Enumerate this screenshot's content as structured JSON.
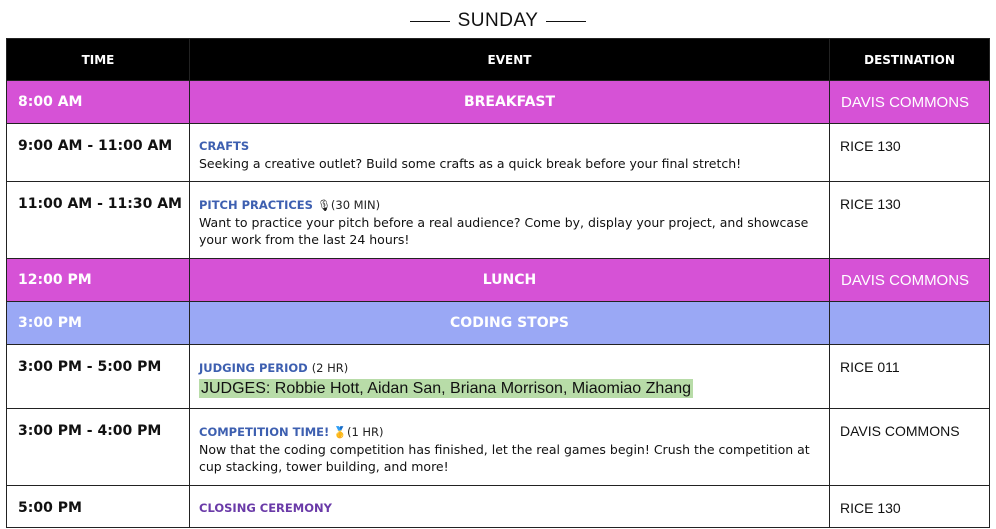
{
  "day": "SUNDAY",
  "columns": {
    "time": "TIME",
    "event": "EVENT",
    "destination": "DESTINATION"
  },
  "rows": [
    {
      "time": "8:00 AM",
      "event": "BREAKFAST",
      "destination": "DAVIS COMMONS"
    },
    {
      "time": "9:00 AM - 11:00 AM",
      "title": "CRAFTS",
      "description": "Seeking a creative outlet? Build some crafts as a quick break before your final stretch!",
      "destination": "RICE 130"
    },
    {
      "time": "11:00 AM - 11:30 AM",
      "title": "PITCH PRACTICES",
      "icon": "microphone-icon",
      "icon_glyph": "🎙",
      "extra": "(30 MIN)",
      "description": "Want to practice your pitch before a real audience? Come by, display your project, and showcase your work from the last 24 hours!",
      "destination": "RICE 130"
    },
    {
      "time": "12:00 PM",
      "event": "LUNCH",
      "destination": "DAVIS COMMONS"
    },
    {
      "time": "3:00 PM",
      "event": "CODING STOPS",
      "destination": ""
    },
    {
      "time": "3:00 PM - 5:00 PM",
      "title": "JUDGING PERIOD",
      "extra": "(2 HR)",
      "judges": "JUDGES: Robbie Hott, Aidan San, Briana Morrison, Miaomiao Zhang",
      "destination": "RICE 011"
    },
    {
      "time": "3:00 PM - 4:00 PM",
      "title": "COMPETITION TIME!",
      "icon": "medal-icon",
      "icon_glyph": "🥇",
      "extra": "(1 HR)",
      "description": "Now that the coding competition has finished, let the real games begin! Crush the competition at cup stacking, tower building, and more!",
      "destination": "DAVIS COMMONS"
    },
    {
      "time": "5:00 PM",
      "title": "CLOSING CEREMONY",
      "destination": "RICE 130"
    }
  ],
  "colors": {
    "meal": "#d652d6",
    "coding_stops": "#9aa8f5",
    "header": "#000000",
    "judges_highlight": "#b8dca8",
    "title_blue": "#3d5fb0",
    "title_purple": "#6a3aa8"
  }
}
